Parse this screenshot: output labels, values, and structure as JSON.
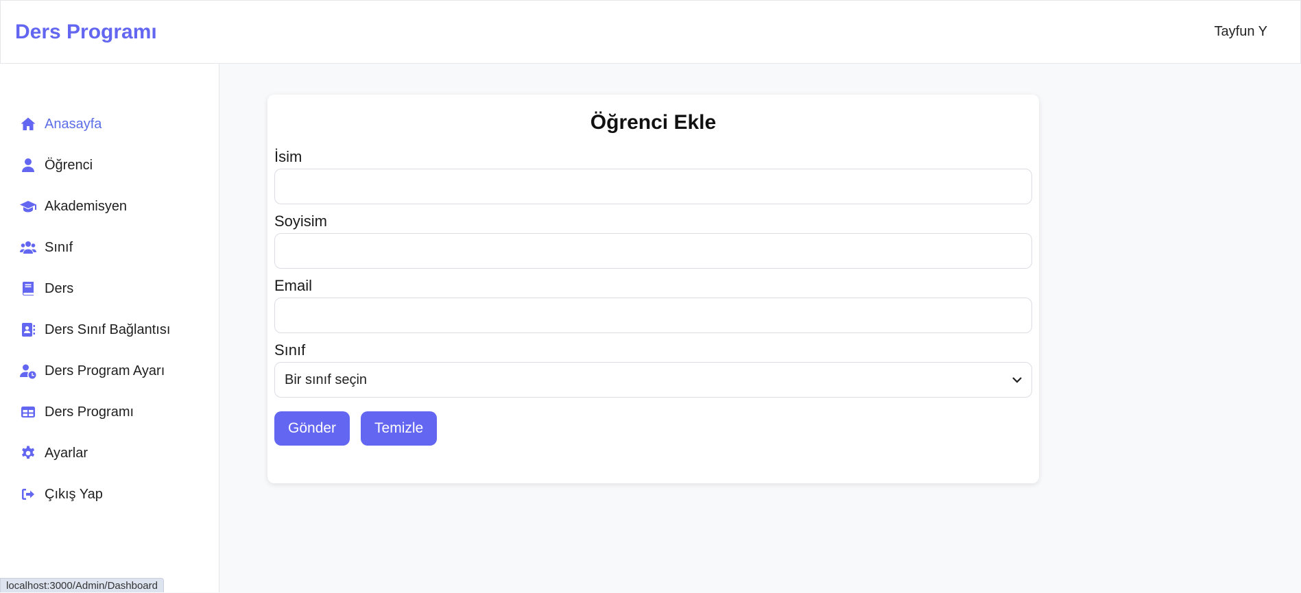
{
  "header": {
    "brand": "Ders Programı",
    "user_name": "Tayfun Y"
  },
  "sidebar": {
    "items": [
      {
        "label": "Anasayfa",
        "icon": "home-icon",
        "active": true
      },
      {
        "label": "Öğrenci",
        "icon": "user-icon"
      },
      {
        "label": "Akademisyen",
        "icon": "graduation-cap-icon"
      },
      {
        "label": "Sınıf",
        "icon": "users-icon"
      },
      {
        "label": "Ders",
        "icon": "book-icon"
      },
      {
        "label": "Ders Sınıf Bağlantısı",
        "icon": "address-book-icon"
      },
      {
        "label": "Ders Program Ayarı",
        "icon": "user-clock-icon"
      },
      {
        "label": "Ders Programı",
        "icon": "table-icon"
      },
      {
        "label": "Ayarlar",
        "icon": "gear-icon"
      },
      {
        "label": "Çıkış Yap",
        "icon": "logout-icon"
      }
    ]
  },
  "form": {
    "title": "Öğrenci Ekle",
    "name_label": "İsim",
    "name_value": "",
    "surname_label": "Soyisim",
    "surname_value": "",
    "email_label": "Email",
    "email_value": "",
    "class_label": "Sınıf",
    "class_selected": "Bir sınıf seçin",
    "submit_label": "Gönder",
    "clear_label": "Temizle"
  },
  "status_bar": {
    "url": "localhost:3000/Admin/Dashboard"
  },
  "colors": {
    "accent": "#6366f1",
    "active_nav_text": "#5b6ee8",
    "page_background": "#f8f9fb"
  }
}
